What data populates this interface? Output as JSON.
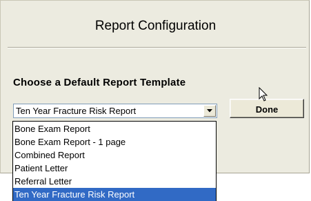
{
  "dialog": {
    "title": "Report Configuration",
    "prompt": "Choose a Default Report Template",
    "done_label": "Done"
  },
  "combo": {
    "selected_value": "Ten Year Fracture Risk Report",
    "arrow_icon": "chevron-down-icon"
  },
  "dropdown": {
    "options": [
      "Bone Exam Report",
      "Bone Exam Report - 1 page",
      "Combined Report",
      "Patient Letter",
      "Referral Letter",
      "Ten Year Fracture Risk Report"
    ],
    "highlighted": "Ten Year Fracture Risk Report"
  },
  "colors": {
    "dialog_background": "#ecebe0",
    "selection_background": "#316ac5",
    "selection_text": "#ffffff"
  }
}
